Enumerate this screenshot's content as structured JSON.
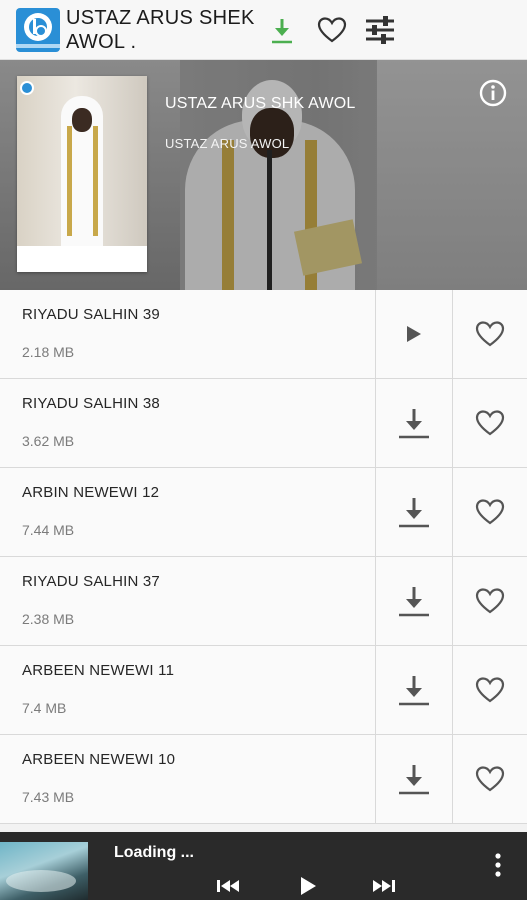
{
  "appbar": {
    "title": "USTAZ ARUS SHEK AWOL .",
    "icons": [
      "app-logo",
      "download-icon",
      "heart-icon",
      "equalizer-settings-icon"
    ],
    "accent": "#4caf50"
  },
  "banner": {
    "title": "USTAZ ARUS SHK AWOL",
    "subtitle": "USTAZ ARUS AWOL"
  },
  "tracks": [
    {
      "title": "RIYADU SALHIN 39",
      "size": "2.18 MB",
      "action": "play"
    },
    {
      "title": "RIYADU SALHIN 38",
      "size": "3.62 MB",
      "action": "download"
    },
    {
      "title": "ARBIN NEWEWI 12",
      "size": "7.44 MB",
      "action": "download"
    },
    {
      "title": "RIYADU SALHIN 37",
      "size": "2.38 MB",
      "action": "download"
    },
    {
      "title": "ARBEEN NEWEWI 11",
      "size": "7.4 MB",
      "action": "download"
    },
    {
      "title": "ARBEEN NEWEWI 10",
      "size": "7.43 MB",
      "action": "download"
    }
  ],
  "player": {
    "status": "Loading ...",
    "controls": [
      "previous-icon",
      "play-icon",
      "next-icon",
      "more-icon"
    ]
  }
}
